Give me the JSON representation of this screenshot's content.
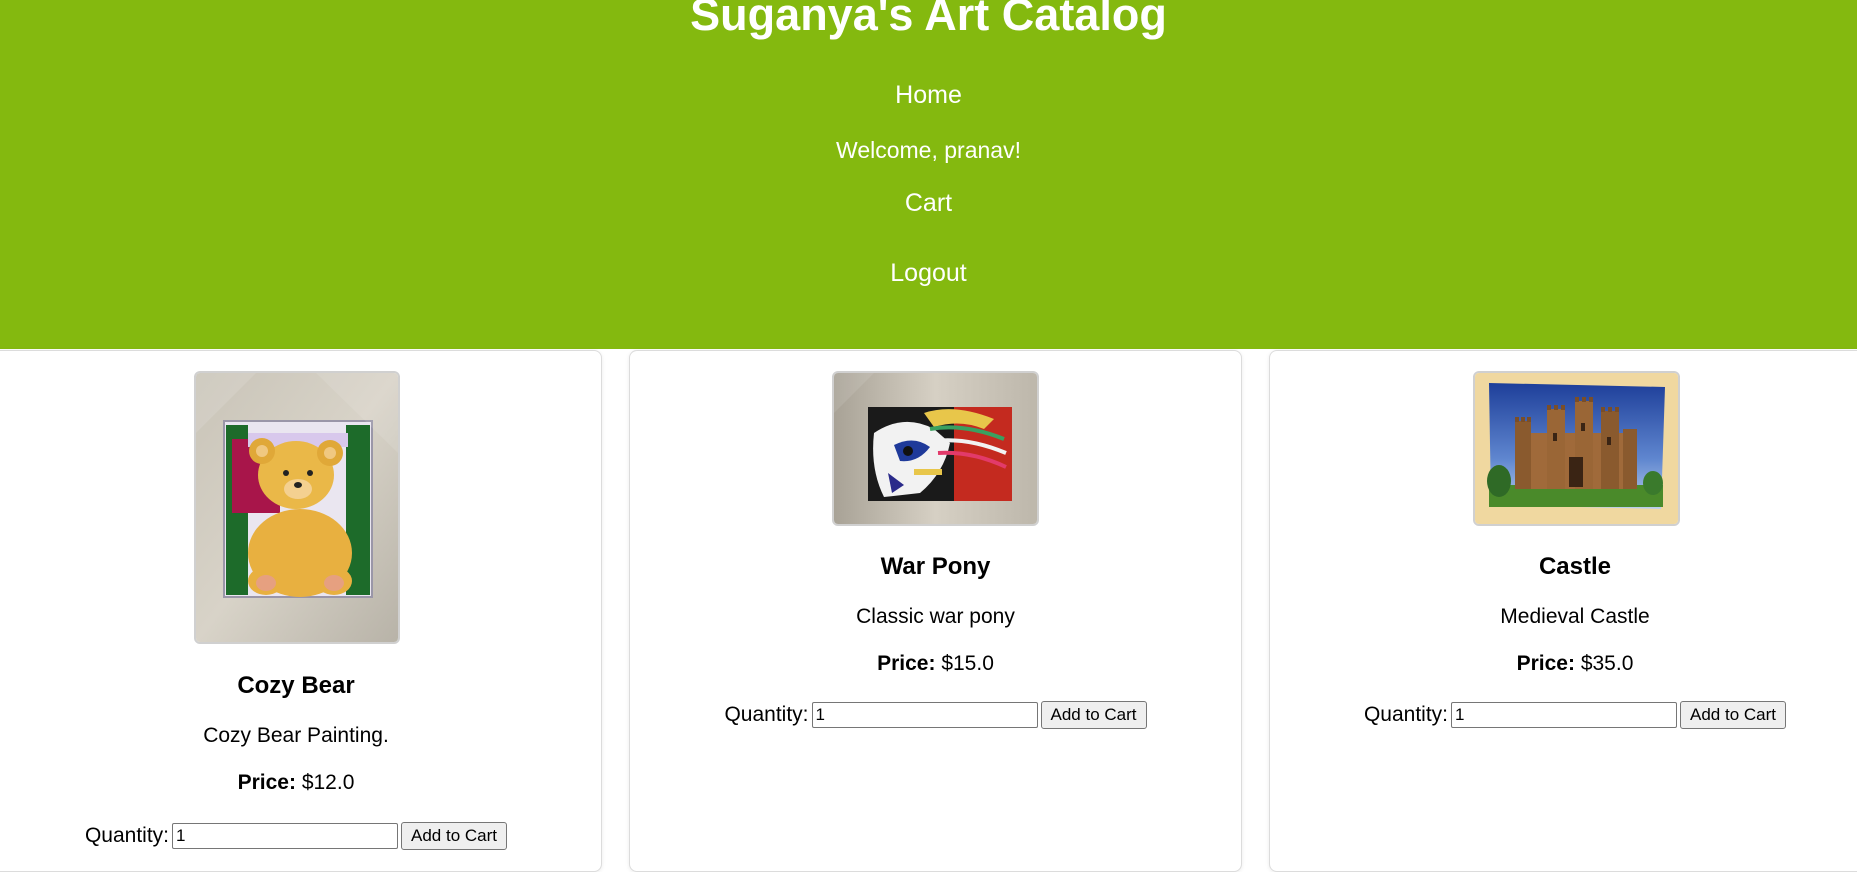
{
  "header": {
    "title": "Suganya's Art Catalog",
    "nav": {
      "home": "Home",
      "welcome": "Welcome, pranav!",
      "cart": "Cart",
      "logout": "Logout"
    },
    "bg_color": "#84b90f"
  },
  "products": [
    {
      "name": "Cozy Bear",
      "description": "Cozy Bear Painting.",
      "price_label": "Price:",
      "price": "$12.0",
      "quantity_label": "Quantity:",
      "quantity_value": "1",
      "add_to_cart": "Add to Cart",
      "image": "teddy-bear-painting"
    },
    {
      "name": "War Pony",
      "description": "Classic war pony",
      "price_label": "Price:",
      "price": "$15.0",
      "quantity_label": "Quantity:",
      "quantity_value": "1",
      "add_to_cart": "Add to Cart",
      "image": "war-pony-painting"
    },
    {
      "name": "Castle",
      "description": "Medieval Castle",
      "price_label": "Price:",
      "price": "$35.0",
      "quantity_label": "Quantity:",
      "quantity_value": "1",
      "add_to_cart": "Add to Cart",
      "image": "castle-painting"
    }
  ]
}
